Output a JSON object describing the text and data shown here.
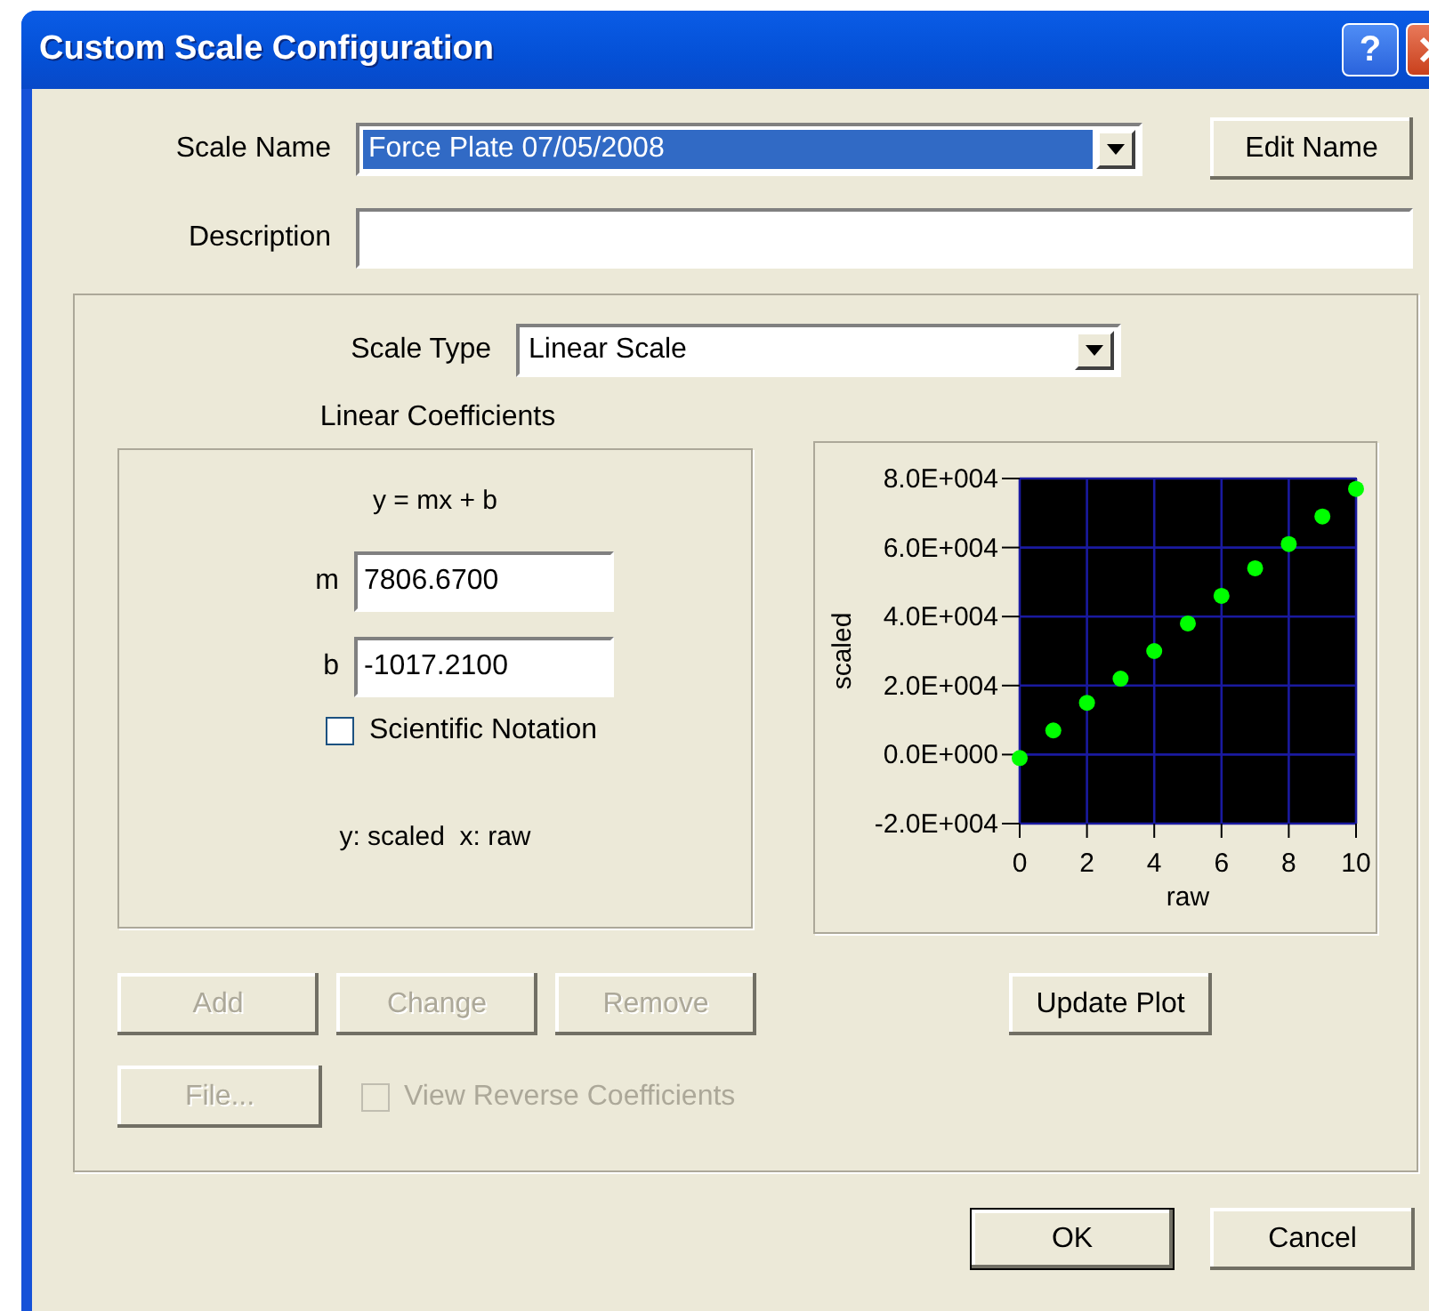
{
  "window": {
    "title": "Custom Scale Configuration",
    "help": "?"
  },
  "scale_name": {
    "label": "Scale Name",
    "value": "Force Plate 07/05/2008",
    "selected": true,
    "button": "Edit Name"
  },
  "description": {
    "label": "Description"
  },
  "scale_type": {
    "label": "Scale Type",
    "value": "Linear Scale"
  },
  "coefficients": {
    "title": "Linear Coefficients",
    "equation": "y = mx + b",
    "fields": [
      {
        "label": "m",
        "value": "7806.6700"
      },
      {
        "label": "b",
        "value": "-1017.2100"
      }
    ],
    "scientific_notation": {
      "label": "Scientific Notation",
      "checked": false,
      "disabled": false
    },
    "legend": "y: scaled  x: raw"
  },
  "chart_data": {
    "type": "scatter",
    "grid": true,
    "xlabel": "raw",
    "ylabel": "scaled",
    "xlim": [
      0,
      10
    ],
    "ylim": [
      -20000,
      80000
    ],
    "xticks": [
      {
        "value": 0,
        "label": "0"
      },
      {
        "value": 2,
        "label": "2"
      },
      {
        "value": 4,
        "label": "4"
      },
      {
        "value": 6,
        "label": "6"
      },
      {
        "value": 8,
        "label": "8"
      },
      {
        "value": 10,
        "label": "10"
      }
    ],
    "yticks": [
      {
        "value": 80000,
        "label": "8.0E+004"
      },
      {
        "value": 60000,
        "label": "6.0E+004"
      },
      {
        "value": 40000,
        "label": "4.0E+004"
      },
      {
        "value": 20000,
        "label": "2.0E+004"
      },
      {
        "value": 0,
        "label": "0.0E+000"
      },
      {
        "value": -20000,
        "label": "-2.0E+004"
      }
    ],
    "x": [
      0,
      1,
      2,
      3,
      4,
      5,
      6,
      7,
      8,
      9,
      10
    ],
    "series": [
      {
        "color": "#00ff00",
        "values": [
          -1000,
          7000,
          15000,
          22000,
          30000,
          38000,
          46000,
          54000,
          61000,
          69000,
          77000
        ]
      }
    ]
  },
  "actions": [
    {
      "label": "Add",
      "disabled": true
    },
    {
      "label": "Change",
      "disabled": true
    },
    {
      "label": "Remove",
      "disabled": true
    }
  ],
  "update_plot": {
    "label": "Update Plot",
    "disabled": false
  },
  "file": {
    "label": "File...",
    "disabled": true
  },
  "view_reverse": {
    "label": "View Reverse Coefficients",
    "checked": false,
    "disabled": true
  },
  "footer": [
    {
      "label": "OK",
      "default": true
    },
    {
      "label": "Cancel",
      "default": false
    }
  ]
}
